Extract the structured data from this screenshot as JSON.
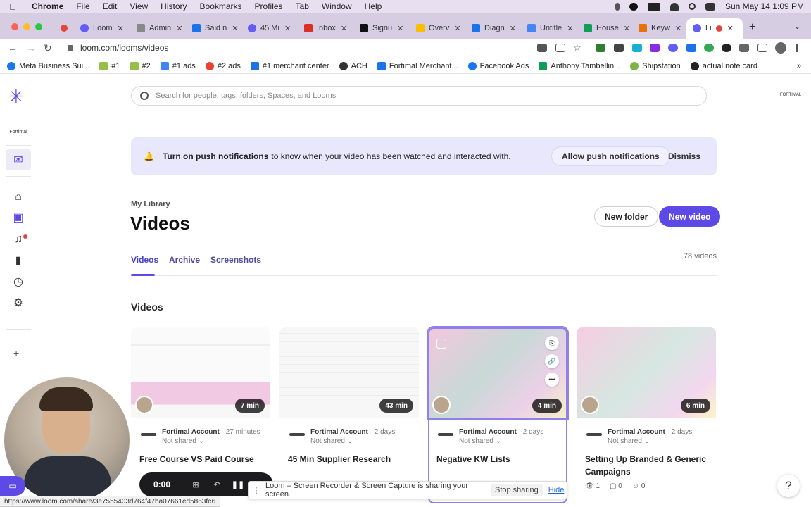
{
  "mac_menu": {
    "app": "Chrome",
    "items": [
      "File",
      "Edit",
      "View",
      "History",
      "Bookmarks",
      "Profiles",
      "Tab",
      "Window",
      "Help"
    ],
    "clock": "Sun May 14  1:09 PM"
  },
  "tabs": [
    {
      "label": "Loom",
      "color": "#625df5"
    },
    {
      "label": "Admin",
      "color": "#888888"
    },
    {
      "label": "Said n",
      "color": "#1a73e8"
    },
    {
      "label": "45 Mi",
      "color": "#625df5"
    },
    {
      "label": "Inbox",
      "color": "#d93025"
    },
    {
      "label": "Signu",
      "color": "#111111"
    },
    {
      "label": "Overv",
      "color": "#fbbc04"
    },
    {
      "label": "Diagn",
      "color": "#1a73e8"
    },
    {
      "label": "Untitle",
      "color": "#4285f4"
    },
    {
      "label": "House",
      "color": "#0f9d58"
    },
    {
      "label": "Keyw",
      "color": "#e8710a"
    },
    {
      "label": "Li",
      "color": "#625df5"
    }
  ],
  "address": {
    "url": "loom.com/looms/videos"
  },
  "bookmarks": [
    {
      "label": "Meta Business Sui...",
      "color": "#1877f2"
    },
    {
      "label": "#1",
      "color": "#95bf47"
    },
    {
      "label": "#2",
      "color": "#95bf47"
    },
    {
      "label": "#1 ads",
      "color": "#4285f4"
    },
    {
      "label": "#2 ads",
      "color": "#ea4335"
    },
    {
      "label": "#1 merchant center",
      "color": "#1a73e8"
    },
    {
      "label": "ACH",
      "color": "#333333"
    },
    {
      "label": "Fortimal Merchant...",
      "color": "#1a73e8"
    },
    {
      "label": "Facebook Ads",
      "color": "#1877f2"
    },
    {
      "label": "Anthony Tambellin...",
      "color": "#0f9d58"
    },
    {
      "label": "Shipstation",
      "color": "#7cb342"
    },
    {
      "label": "actual note card",
      "color": "#222222"
    }
  ],
  "sidebar": {
    "workspace": "Fortimal"
  },
  "search": {
    "placeholder": "Search for people, tags, folders, Spaces, and Looms"
  },
  "header_logo": "FORTIMAL",
  "banner": {
    "bold": "Turn on push notifications",
    "rest": "to know when your video has been watched and interacted with.",
    "allow_label": "Allow push notifications",
    "dismiss_label": "Dismiss"
  },
  "library": {
    "crumb": "My Library",
    "title": "Videos",
    "new_folder": "New folder",
    "new_video": "New video",
    "tabs": [
      "Videos",
      "Archive",
      "Screenshots"
    ],
    "count": "78 videos",
    "section": "Videos"
  },
  "videos": [
    {
      "duration": "7 min",
      "owner": "Fortimal Account",
      "ago": "· 27 minutes",
      "share": "Not shared",
      "title": "Free Course VS Paid Course"
    },
    {
      "duration": "43 min",
      "owner": "Fortimal Account",
      "ago": "· 2 days",
      "share": "Not shared",
      "title": "45 Min Supplier Research"
    },
    {
      "duration": "4 min",
      "owner": "Fortimal Account",
      "ago": "· 2 days",
      "share": "Not shared",
      "title": "Negative KW Lists"
    },
    {
      "duration": "6 min",
      "owner": "Fortimal Account",
      "ago": "· 2 days",
      "share": "Not shared",
      "title": "Setting Up Branded & Generic Campaigns",
      "views": "1",
      "comments": "0",
      "reactions": "0"
    }
  ],
  "recorder": {
    "time": "0:00"
  },
  "sharing": {
    "message": "Loom – Screen Recorder & Screen Capture is sharing your screen.",
    "stop": "Stop sharing",
    "hide": "Hide"
  },
  "status_url": "https://www.loom.com/share/3e7555403d764f47ba07661ed5863fe6",
  "accent": "#5d4ae6"
}
